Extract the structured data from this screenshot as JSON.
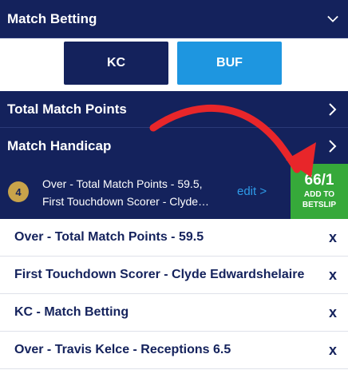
{
  "match_betting": {
    "title": "Match Betting",
    "icon": "chevron-down-icon"
  },
  "teams": {
    "home": "KC",
    "away": "BUF",
    "home_color": "#14225c",
    "away_color": "#1e96e0"
  },
  "markets": [
    {
      "label": "Total Match Points",
      "icon": "chevron-right-icon"
    },
    {
      "label": "Match Handicap",
      "icon": "chevron-right-icon"
    }
  ],
  "selection_bar": {
    "count": "4",
    "line1": "Over - Total Match Points - 59.5,",
    "line2": "First Touchdown Scorer - Clyde…",
    "edit": "edit >",
    "odds": "66/1",
    "add_label_1": "ADD TO",
    "add_label_2": "BETSLIP",
    "odds_color": "#36a93a"
  },
  "selections": [
    {
      "label": "Over - Total Match Points - 59.5",
      "remove": "x"
    },
    {
      "label": "First Touchdown Scorer - Clyde Edwardshelaire",
      "remove": "x"
    },
    {
      "label": "KC - Match Betting",
      "remove": "x"
    },
    {
      "label": "Over - Travis Kelce - Receptions 6.5",
      "remove": "x"
    }
  ],
  "annotation": {
    "arrow_color": "#e8262a"
  }
}
